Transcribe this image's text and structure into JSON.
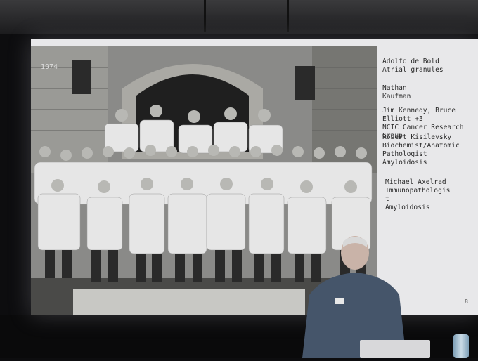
{
  "slide": {
    "year": "1974",
    "entries": [
      "Adolfo de Bold\nAtrial granules",
      "Nathan\nKaufman",
      "Jim Kennedy, Bruce\nElliott +3\nNCIC Cancer Research\nGroup",
      "Robert Kisilevsky\nBiochemist/Anatomic\nPathologist\nAmyloidosis",
      "Michael Axelrad\nImmunopathologis\nt\nAmyloidosis"
    ],
    "page_number": "8"
  },
  "colors": {
    "screen_bg": "#e8e8ea",
    "photo_bg": "#6b6b6b",
    "coat": "#e6e6e6"
  }
}
